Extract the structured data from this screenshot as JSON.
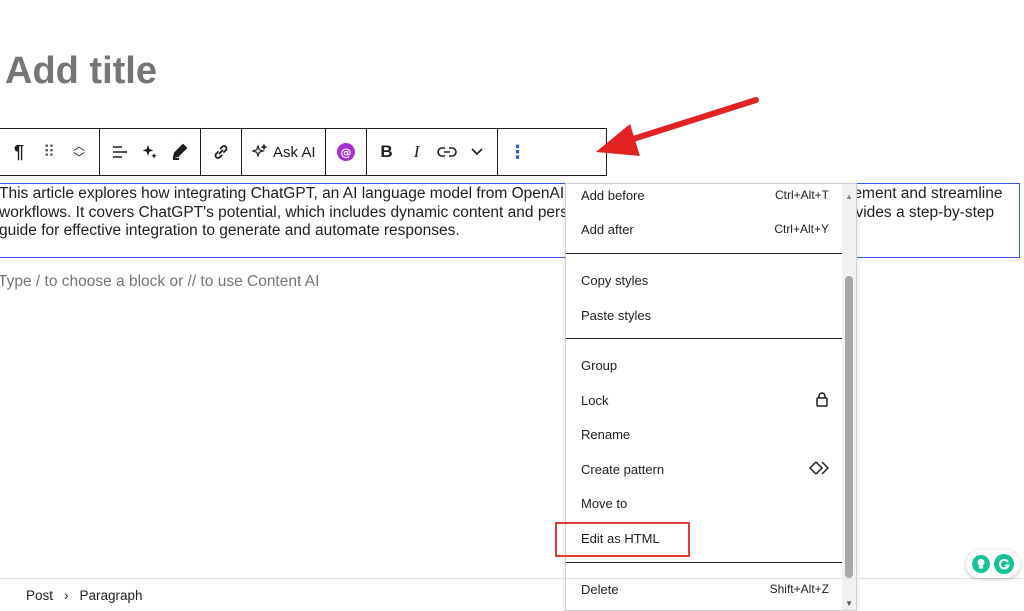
{
  "editor": {
    "title_placeholder": "Add title",
    "paragraph_text": "This article explores how integrating ChatGPT, an AI language model from OpenAI, into WordPress can enhance user engagement and streamline workflows. It covers ChatGPT's potential, which includes dynamic content and personalized user experiences. The article provides a step-by-step guide for effective integration to generate and automate responses.",
    "block_placeholder": "Type / to choose a block or // to use Content AI"
  },
  "toolbar": {
    "paragraph_icon": "¶",
    "drag_icon": "⠿",
    "ask_ai_label": "Ask AI",
    "bold_label": "B",
    "italic_label": "I",
    "more_icon": "⋮"
  },
  "menu": {
    "items": [
      {
        "label": "Add before",
        "shortcut": "Ctrl+Alt+T"
      },
      {
        "label": "Add after",
        "shortcut": "Ctrl+Alt+Y"
      },
      {
        "label": "Copy styles",
        "shortcut": ""
      },
      {
        "label": "Paste styles",
        "shortcut": ""
      },
      {
        "label": "Group",
        "shortcut": ""
      },
      {
        "label": "Lock",
        "shortcut": ""
      },
      {
        "label": "Rename",
        "shortcut": ""
      },
      {
        "label": "Create pattern",
        "shortcut": ""
      },
      {
        "label": "Move to",
        "shortcut": ""
      },
      {
        "label": "Edit as HTML",
        "shortcut": ""
      },
      {
        "label": "Delete",
        "shortcut": "Shift+Alt+Z"
      }
    ]
  },
  "breadcrumb": {
    "post": "Post",
    "separator": "›",
    "paragraph": "Paragraph"
  },
  "colors": {
    "accent": "#3858e9",
    "highlight": "#e53935",
    "grammarly": "#15c39a"
  }
}
